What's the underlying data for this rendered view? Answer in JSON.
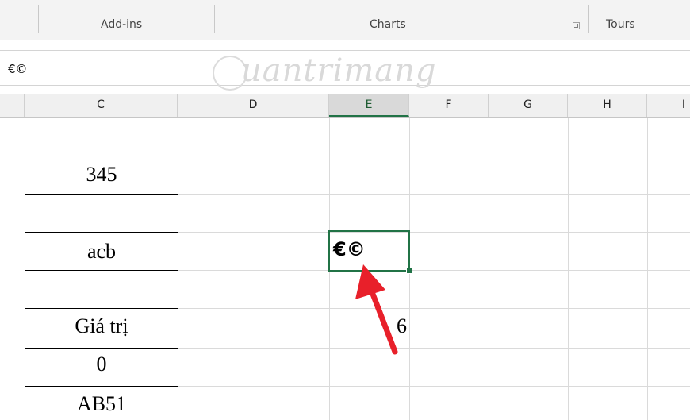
{
  "ribbon": {
    "groups": [
      {
        "label": "Add-ins"
      },
      {
        "label": "Charts"
      },
      {
        "label": "Tours"
      }
    ]
  },
  "formula_bar": {
    "value": "€©"
  },
  "watermark": {
    "text": "uantrimang"
  },
  "columns": [
    "C",
    "D",
    "E",
    "F",
    "G",
    "H",
    "I"
  ],
  "active_column": "E",
  "cells": {
    "c2": "345",
    "c4": "acb",
    "c6": "Giá trị",
    "c7": "0",
    "c8": "AB51",
    "e4": "€©",
    "e6": "6"
  },
  "colors": {
    "selection": "#217346",
    "arrow": "#e8202a"
  }
}
